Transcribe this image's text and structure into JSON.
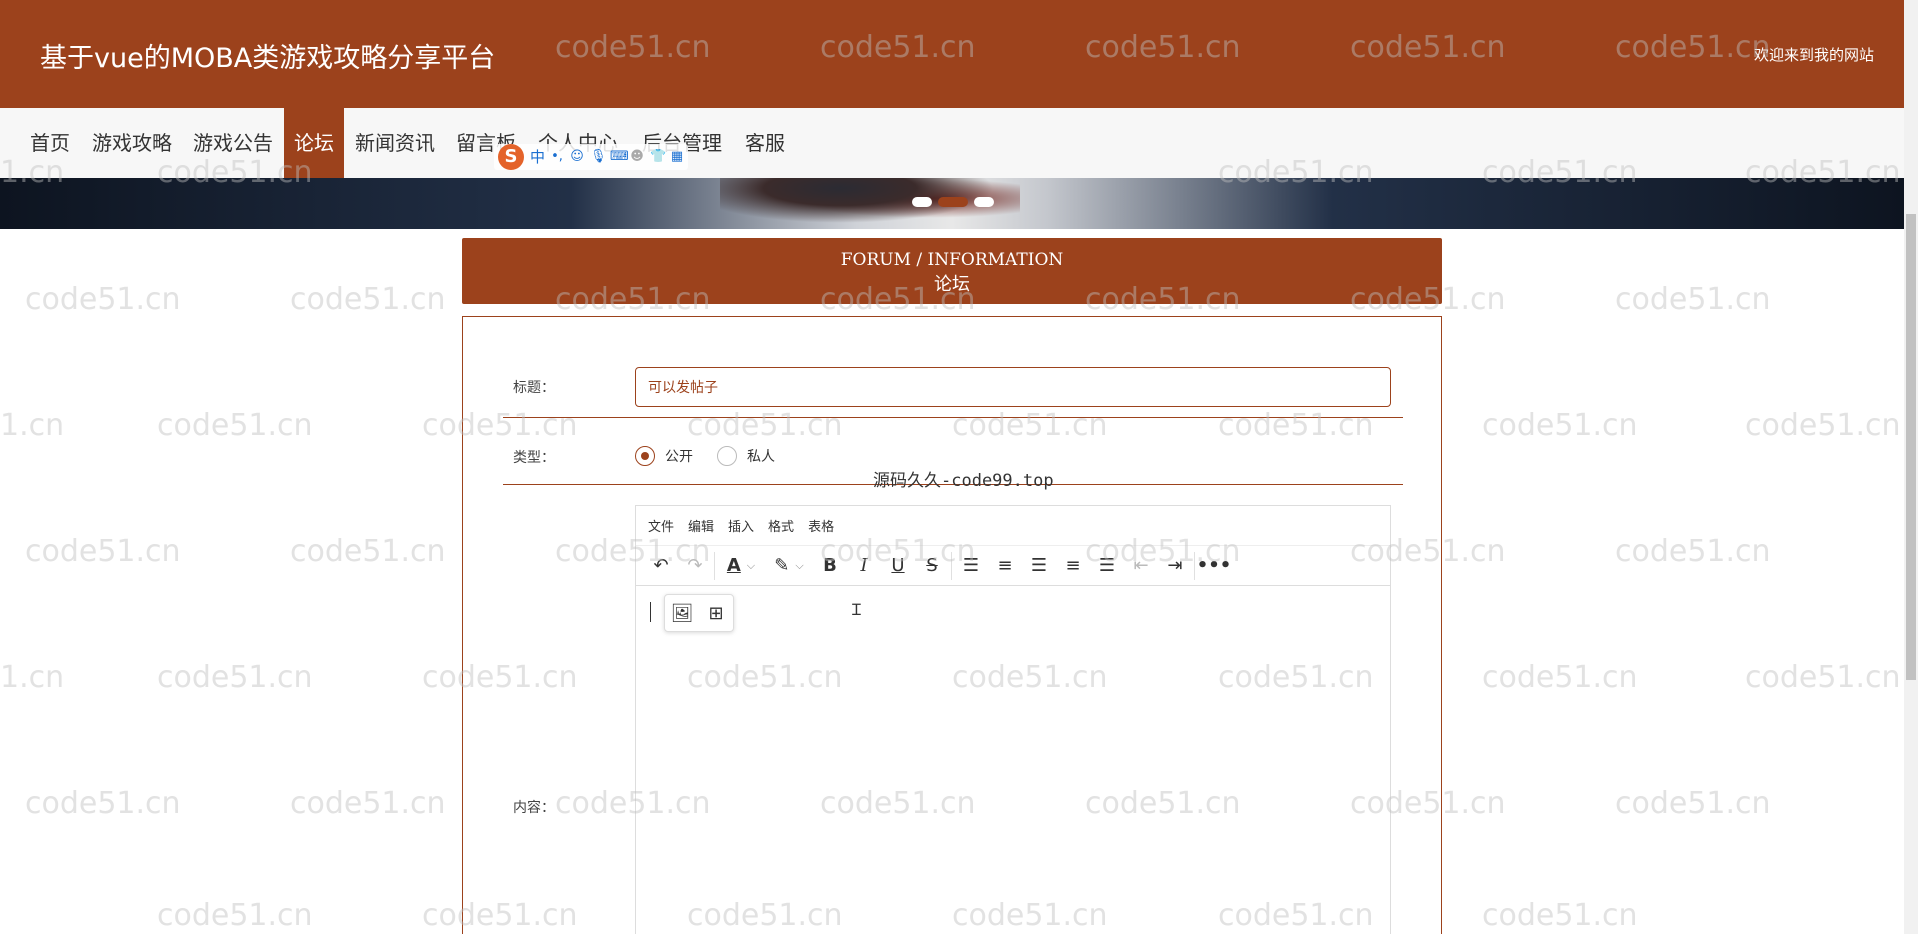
{
  "header": {
    "site_title": "基于vue的MOBA类游戏攻略分享平台",
    "welcome": "欢迎来到我的网站"
  },
  "nav": {
    "items": [
      {
        "label": "首页"
      },
      {
        "label": "游戏攻略"
      },
      {
        "label": "游戏公告"
      },
      {
        "label": "论坛"
      },
      {
        "label": "新闻资讯"
      },
      {
        "label": "留言板"
      },
      {
        "label": "个人中心"
      },
      {
        "label": "后台管理"
      },
      {
        "label": "客服"
      }
    ],
    "active": "论坛"
  },
  "ime": {
    "logo": "S",
    "mode": "中",
    "punct": "•,",
    "icons": [
      "smiley-icon",
      "microphone-icon",
      "keyboard-icon",
      "user-icon",
      "skin-icon",
      "grid-icon"
    ]
  },
  "banner": {
    "slide_count": 3,
    "active_slide": 2
  },
  "forum": {
    "heading_en": "FORUM / INFORMATION",
    "heading_cn": "论坛"
  },
  "form": {
    "title_label": "标题：",
    "title_value": "可以发帖子",
    "type_label": "类型：",
    "type_options": [
      {
        "label": "公开",
        "checked": true
      },
      {
        "label": "私人",
        "checked": false
      }
    ],
    "content_label": "内容："
  },
  "editor": {
    "menus": [
      "文件",
      "编辑",
      "插入",
      "格式",
      "表格"
    ],
    "toolbar_icons": [
      "undo-icon",
      "redo-icon",
      "text-color-icon",
      "highlight-icon",
      "bold-icon",
      "italic-icon",
      "underline-icon",
      "strikethrough-icon",
      "line-height-icon",
      "align-left-icon",
      "align-center-icon",
      "align-right-icon",
      "align-justify-icon",
      "outdent-icon",
      "indent-icon",
      "more-icon"
    ],
    "quick_insert_icons": [
      "image-icon",
      "table-icon"
    ]
  },
  "watermark": {
    "text": "code51.cn",
    "text_partial": "1.cn",
    "secondary": "源码久久-code99.top"
  },
  "colors": {
    "brand": "#9c421c",
    "nav_bg": "#f7f7f7"
  }
}
